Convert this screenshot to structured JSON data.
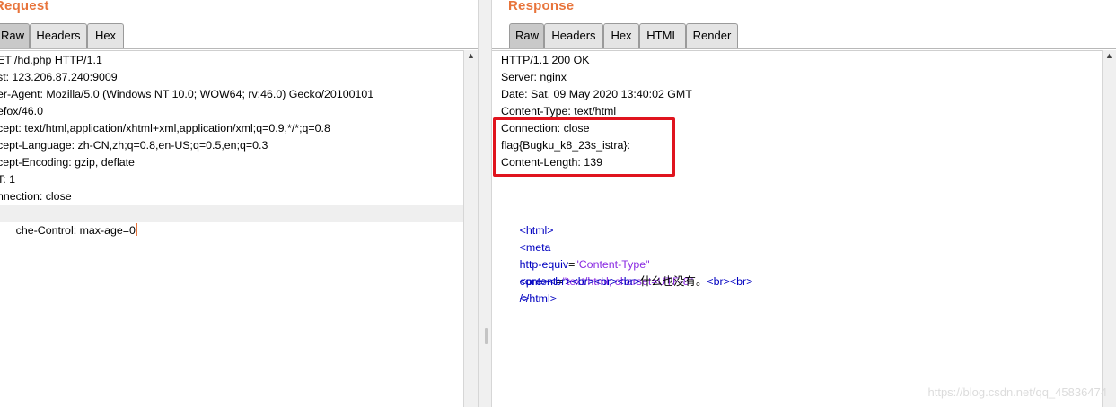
{
  "request": {
    "title": "Request",
    "tabs": [
      "Raw",
      "Headers",
      "Hex"
    ],
    "active_tab": "Raw",
    "lines": [
      "ET /hd.php HTTP/1.1",
      "st: 123.206.87.240:9009",
      "er-Agent: Mozilla/5.0 (Windows NT 10.0; WOW64; rv:46.0) Gecko/20100101",
      "efox/46.0",
      "cept: text/html,application/xhtml+xml,application/xml;q=0.9,*/*;q=0.8",
      "cept-Language: zh-CN,zh;q=0.8,en-US;q=0.5,en;q=0.3",
      "cept-Encoding: gzip, deflate",
      "T: 1",
      "nnection: close",
      "che-Control: max-age=0"
    ]
  },
  "response": {
    "title": "Response",
    "tabs": [
      "Raw",
      "Headers",
      "Hex",
      "HTML",
      "Render"
    ],
    "active_tab": "Raw",
    "header_lines": [
      "HTTP/1.1 200 OK",
      "Server: nginx",
      "Date: Sat, 09 May 2020 13:40:02 GMT",
      "Content-Type: text/html",
      "Connection: close",
      "flag{Bugku_k8_23s_istra}:",
      "Content-Length: 139"
    ],
    "body": {
      "html_open": "<html>",
      "meta": {
        "open": "<meta",
        "attr1_name": "http-equiv",
        "attr1_value": "\"Content-Type\"",
        "attr2_name": "content",
        "attr2_value": "\"text/html; charset=UTF-8\"",
        "close": "/>"
      },
      "pre_line": {
        "tags": "<pre><br><br><br><br>",
        "text": "什么也没有。",
        "tail": "<br><br>"
      },
      "html_close": "</html>"
    }
  },
  "colors": {
    "accent": "#e8743b",
    "highlight_box": "#e0141e",
    "tag": "#0000c0",
    "string": "#8a2be2"
  },
  "watermark": "https://blog.csdn.net/qq_45836474"
}
